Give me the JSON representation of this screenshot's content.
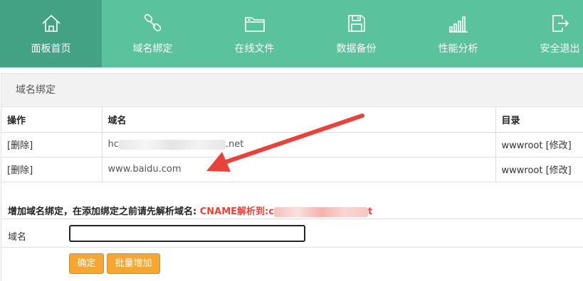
{
  "nav": {
    "items": [
      {
        "label": "面板首页",
        "icon": "home-icon",
        "active": true
      },
      {
        "label": "域名绑定",
        "icon": "link-icon"
      },
      {
        "label": "在线文件",
        "icon": "folder-icon"
      },
      {
        "label": "数据备份",
        "icon": "save-icon"
      },
      {
        "label": "性能分析",
        "icon": "bar-chart-icon"
      },
      {
        "label": "安全退出",
        "icon": "logout-icon"
      }
    ]
  },
  "panel": {
    "title": "域名绑定",
    "table": {
      "headers": [
        "操作",
        "域名",
        "目录"
      ],
      "rows": [
        {
          "action": "[删除]",
          "domain_prefix": "hc",
          "domain_suffix": ".net",
          "directory": "wwwroot",
          "edit": "[修改]",
          "redacted": true
        },
        {
          "action": "[删除]",
          "domain": "www.baidu.com",
          "directory": "wwwroot",
          "edit": "[修改]"
        }
      ]
    },
    "add_notice": "增加域名绑定，在添加绑定之前请先解析域名:",
    "cname_label": "CNAME解析到:",
    "cname_prefix": "c",
    "cname_suffix": "t",
    "field_label": "域名",
    "input_value": "",
    "confirm_label": "确定",
    "batch_label": "批量增加"
  },
  "colors": {
    "nav_bg": "#5ac29d",
    "nav_active_bg": "#43a283",
    "button_bg": "#f6a633",
    "accent_red": "#e8433a"
  }
}
